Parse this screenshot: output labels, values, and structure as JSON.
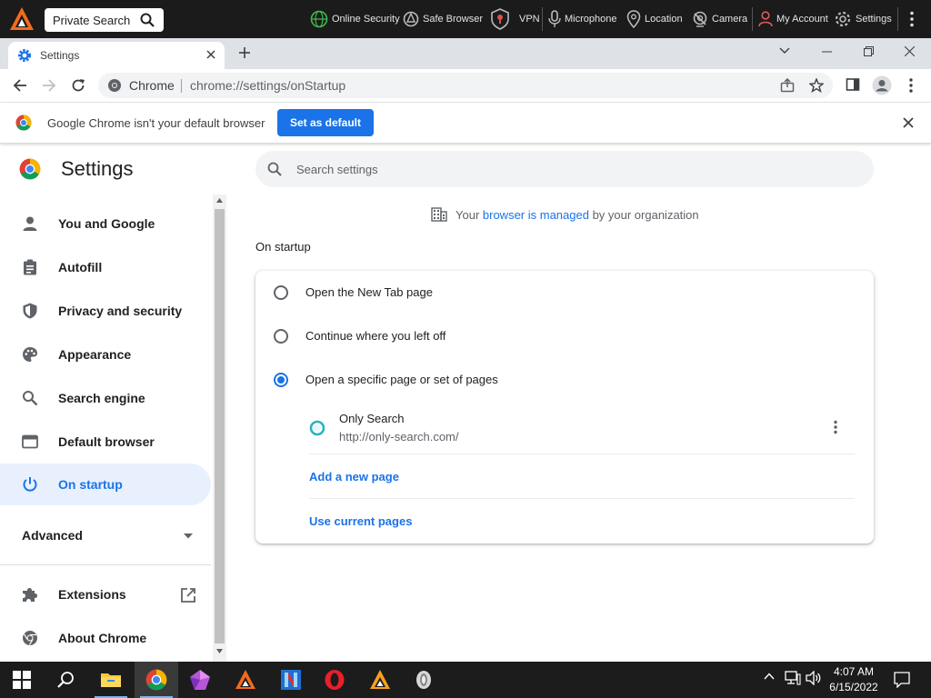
{
  "topbar": {
    "search_value": "Private Search",
    "items": [
      {
        "label": "Online Security",
        "icon": "globe-shield-icon"
      },
      {
        "label": "Safe Browser",
        "icon": "safe-browser-icon"
      },
      {
        "label": "VPN",
        "icon": "vpn-shield-icon"
      },
      {
        "label": "Microphone",
        "icon": "microphone-icon"
      },
      {
        "label": "Location",
        "icon": "location-pin-icon"
      },
      {
        "label": "Camera",
        "icon": "camera-icon"
      },
      {
        "label": "My Account",
        "icon": "user-icon"
      },
      {
        "label": "Settings",
        "icon": "gear-icon"
      }
    ]
  },
  "tab": {
    "title": "Settings"
  },
  "omnibox": {
    "site_label": "Chrome",
    "url": "chrome://settings/onStartup"
  },
  "infobar": {
    "message": "Google Chrome isn't your default browser",
    "button": "Set as default"
  },
  "settings": {
    "title": "Settings",
    "search_placeholder": "Search settings",
    "managed": {
      "prefix": "Your ",
      "link": "browser is managed",
      "suffix": " by your organization"
    },
    "sidebar": {
      "items": [
        {
          "label": "You and Google",
          "icon": "person-icon"
        },
        {
          "label": "Autofill",
          "icon": "clipboard-icon"
        },
        {
          "label": "Privacy and security",
          "icon": "shield-icon"
        },
        {
          "label": "Appearance",
          "icon": "palette-icon"
        },
        {
          "label": "Search engine",
          "icon": "search-icon"
        },
        {
          "label": "Default browser",
          "icon": "browser-window-icon"
        },
        {
          "label": "On startup",
          "icon": "power-icon"
        }
      ],
      "active": "On startup",
      "advanced": "Advanced",
      "extensions": "Extensions",
      "about": "About Chrome"
    },
    "on_startup": {
      "section_title": "On startup",
      "options": [
        "Open the New Tab page",
        "Continue where you left off",
        "Open a specific page or set of pages"
      ],
      "selected_index": 2,
      "page": {
        "name": "Only Search",
        "url": "http://only-search.com/"
      },
      "add_link": "Add a new page",
      "current_link": "Use current pages"
    }
  },
  "taskbar": {
    "time": "4:07 AM",
    "date": "6/15/2022"
  }
}
